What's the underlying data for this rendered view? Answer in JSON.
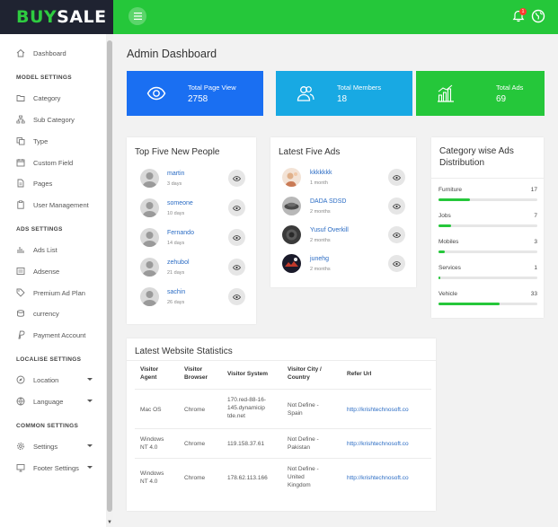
{
  "logo": {
    "part1": "BUY",
    "part2": "SALE"
  },
  "header": {
    "notification_count": "1"
  },
  "sidebar": {
    "dashboard": "Dashboard",
    "model_settings": "MODEL SETTINGS",
    "category": "Category",
    "sub_category": "Sub Category",
    "type": "Type",
    "custom_field": "Custom Field",
    "pages": "Pages",
    "user_management": "User Management",
    "ads_settings": "ADS SETTINGS",
    "ads_list": "Ads List",
    "adsense": "Adsense",
    "premium_ad_plan": "Premium Ad Plan",
    "currency": "currency",
    "payment_account": "Payment Account",
    "localise_settings": "LOCALISE SETTINGS",
    "location": "Location",
    "language": "Language",
    "common_settings": "COMMON SETTINGS",
    "settings": "Settings",
    "footer_settings": "Footer Settings"
  },
  "page_title": "Admin Dashboard",
  "stats": {
    "page_view": {
      "label": "Total Page View",
      "value": "2758",
      "color": "#1a6ff2"
    },
    "members": {
      "label": "Total Members",
      "value": "18",
      "color": "#18a9e3"
    },
    "ads": {
      "label": "Total Ads",
      "value": "69",
      "color": "#25c73a"
    }
  },
  "people": {
    "title": "Top Five New People",
    "items": [
      {
        "name": "martin",
        "meta": "3 days"
      },
      {
        "name": "someone",
        "meta": "10 days"
      },
      {
        "name": "Fernando",
        "meta": "14 days"
      },
      {
        "name": "zehubol",
        "meta": "21 days"
      },
      {
        "name": "sachin",
        "meta": "26 days"
      }
    ]
  },
  "ads": {
    "title": "Latest Five Ads",
    "items": [
      {
        "name": "kkkkkkk",
        "meta": "1 month"
      },
      {
        "name": "DADA SDSD",
        "meta": "2 months"
      },
      {
        "name": "Yusuf Overkill",
        "meta": "2 months"
      },
      {
        "name": "junehg",
        "meta": "2 months"
      }
    ]
  },
  "distribution": {
    "title_line1": "Category wise Ads",
    "title_line2": "Distribution",
    "items": [
      {
        "label": "Furniture",
        "count": "17",
        "fraction": 0.32
      },
      {
        "label": "Jobs",
        "count": "7",
        "fraction": 0.13
      },
      {
        "label": "Mobiles",
        "count": "3",
        "fraction": 0.06
      },
      {
        "label": "Services",
        "count": "1",
        "fraction": 0.02
      },
      {
        "label": "Vehicle",
        "count": "33",
        "fraction": 0.62
      }
    ]
  },
  "statistics": {
    "title": "Latest Website Statistics",
    "headers": {
      "agent_1": "Visitor",
      "agent_2": "Agent",
      "browser_1": "Visitor",
      "browser_2": "Browser",
      "system": "Visitor System",
      "city_1": "Visitor City /",
      "city_2": "Country",
      "refer": "Refer Url"
    },
    "rows": [
      {
        "agent": [
          "Mac OS"
        ],
        "browser": "Chrome",
        "system": [
          "170.red-88-16-",
          "145.dynamicip",
          "tde.net"
        ],
        "city": [
          "Not Define -",
          "Spain"
        ],
        "refer": "http://krishtechnosoft.co"
      },
      {
        "agent": [
          "Windows",
          "NT 4.0"
        ],
        "browser": "Chrome",
        "system": [
          "119.158.37.61"
        ],
        "city": [
          "Not Define -",
          "Pakistan"
        ],
        "refer": "http://krishtechnosoft.co"
      },
      {
        "agent": [
          "Windows",
          "NT 4.0"
        ],
        "browser": "Chrome",
        "system": [
          "178.62.113.166"
        ],
        "city": [
          "Not Define -",
          "United",
          "Kingdom"
        ],
        "refer": "http://krishtechnosoft.co"
      }
    ]
  }
}
